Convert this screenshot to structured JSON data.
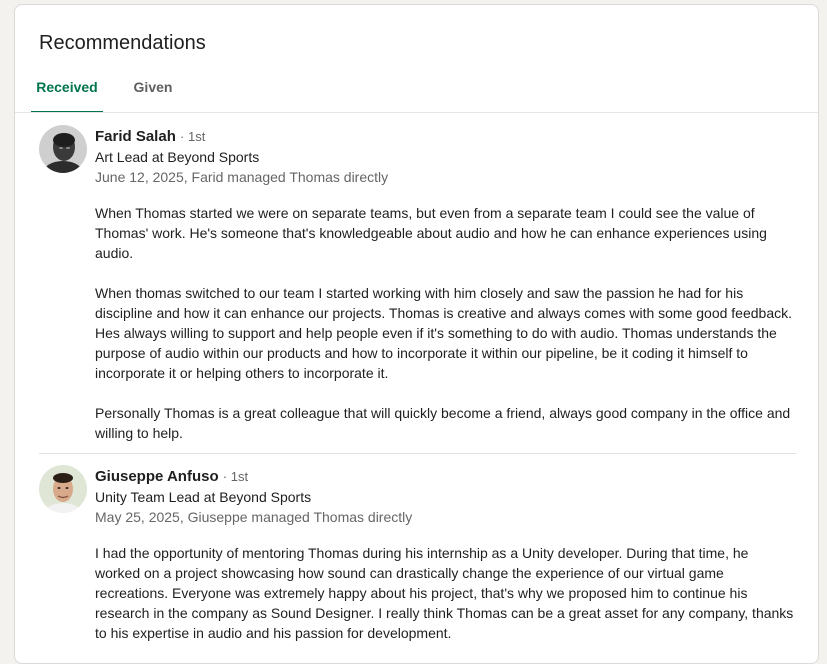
{
  "section": {
    "title": "Recommendations"
  },
  "tabs": [
    {
      "label": "Received",
      "active": true
    },
    {
      "label": "Given",
      "active": false
    }
  ],
  "recommendations": [
    {
      "name": "Farid Salah",
      "degree": "· 1st",
      "headline": "Art Lead at Beyond Sports",
      "meta": "June 12, 2025, Farid managed Thomas directly",
      "paragraphs": [
        "When Thomas started we were on separate teams, but even from a separate team I could see the value of Thomas' work. He's someone that's knowledgeable about audio and how he can enhance experiences using audio.",
        "When thomas switched to our team I started working with him closely and saw the passion he had for his discipline and how it can enhance our projects. Thomas is creative and always comes with some good feedback. Hes always willing to support and help people even if it's something to do with audio. Thomas understands the purpose of audio within our products and how to incorporate it within our pipeline, be it coding it himself to incorporate it or helping others to incorporate it.",
        "Personally Thomas is a great colleague that will quickly become a friend, always good company in the office and willing to help."
      ]
    },
    {
      "name": "Giuseppe Anfuso",
      "degree": "· 1st",
      "headline": "Unity Team Lead at Beyond Sports",
      "meta": "May 25, 2025, Giuseppe managed Thomas directly",
      "paragraphs": [
        "I had the opportunity of mentoring Thomas during his internship as a Unity developer. During that time, he worked on a project showcasing how sound can drastically change the experience of our virtual game recreations. Everyone was extremely happy about his project, that's why we proposed him to continue his research in the company as Sound Designer. I really think Thomas can be a great asset for any company, thanks to his expertise in audio and his passion for development."
      ]
    }
  ],
  "colors": {
    "accent": "#01754f",
    "text": "#1f1f1f",
    "muted": "#666666"
  }
}
